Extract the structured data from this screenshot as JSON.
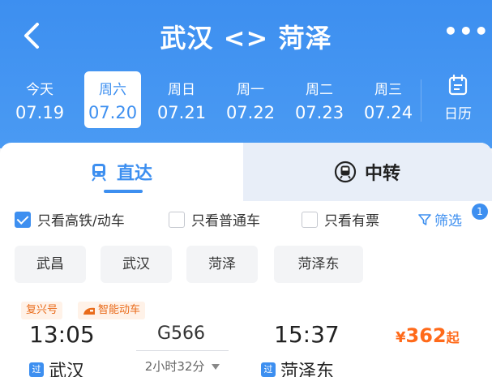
{
  "header": {
    "title": "武汉 <> 菏泽",
    "more_label": "•••",
    "accent": "#3d8ff0"
  },
  "dates": [
    {
      "weekday": "今天",
      "date": "07.19",
      "selected": false
    },
    {
      "weekday": "周六",
      "date": "07.20",
      "selected": true
    },
    {
      "weekday": "周日",
      "date": "07.21",
      "selected": false
    },
    {
      "weekday": "周一",
      "date": "07.22",
      "selected": false
    },
    {
      "weekday": "周二",
      "date": "07.23",
      "selected": false
    },
    {
      "weekday": "周三",
      "date": "07.24",
      "selected": false
    }
  ],
  "calendar": {
    "label": "日历",
    "icon": "calendar-icon"
  },
  "tabs": [
    {
      "label": "直达",
      "icon": "train-icon",
      "active": true
    },
    {
      "label": "中转",
      "icon": "transfer-icon",
      "active": false
    }
  ],
  "filters": [
    {
      "label": "只看高铁/动车",
      "checked": true
    },
    {
      "label": "只看普通车",
      "checked": false
    },
    {
      "label": "只看有票",
      "checked": false
    }
  ],
  "screen": {
    "label": "筛选",
    "badge": "1",
    "icon": "filter-icon"
  },
  "stations": [
    "武昌",
    "武汉",
    "菏泽",
    "菏泽东"
  ],
  "train": {
    "tags": [
      "复兴号",
      "智能动车"
    ],
    "depart_time": "13:05",
    "arrive_time": "15:37",
    "code": "G566",
    "duration": "2小时32分",
    "price_currency": "¥",
    "price_value": "362",
    "price_unit": "起",
    "pass_mark": "过",
    "depart_station": "武汉",
    "arrive_station": "菏泽东",
    "price_color": "#ff6a1a"
  }
}
